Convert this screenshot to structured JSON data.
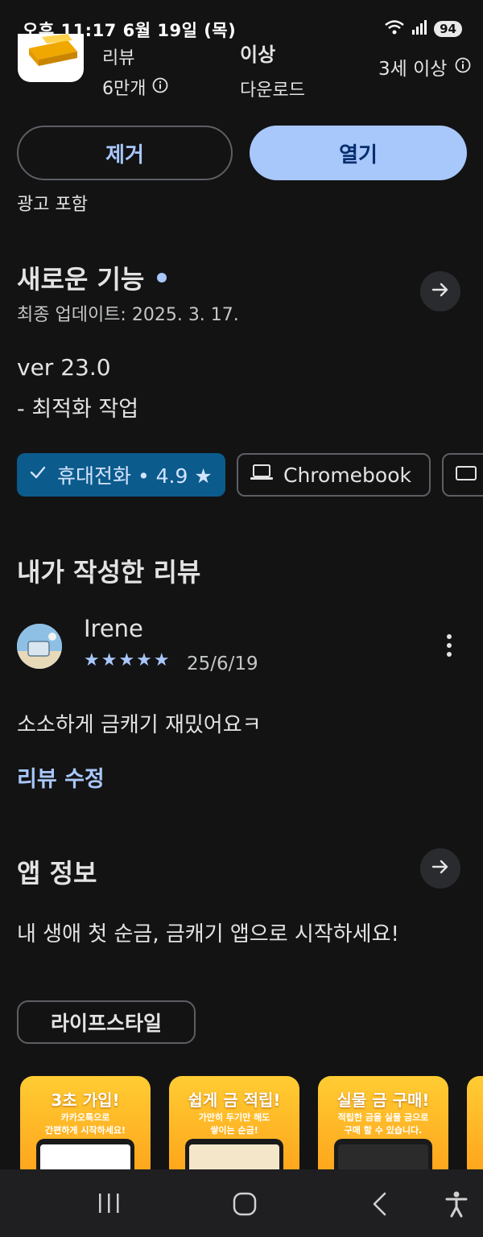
{
  "status_bar": {
    "time": "오후 11:17 6월 19일 (목)",
    "battery": "94"
  },
  "app_stats": {
    "reviews_label": "리뷰",
    "reviews_count": "6만개",
    "downloads_top": "이상",
    "downloads_label": "다운로드",
    "age_rating": "3세 이상"
  },
  "actions": {
    "remove": "제거",
    "open": "열기"
  },
  "ads_notice": "광고 포함",
  "whats_new": {
    "title": "새로운 기능",
    "last_updated": "최종 업데이트: 2025. 3. 17.",
    "version": "ver 23.0",
    "notes": "- 최적화 작업"
  },
  "device_chips": [
    {
      "label": "휴대전화 • 4.9 ★",
      "selected": true
    },
    {
      "label": "Chromebook",
      "selected": false
    },
    {
      "label": "",
      "selected": false
    }
  ],
  "my_review": {
    "title": "내가 작성한 리뷰",
    "author": "Irene",
    "rating": 5,
    "stars": "★★★★★",
    "date": "25/6/19",
    "text": "소소하게 금캐기 재밌어요ㅋ",
    "edit_label": "리뷰 수정"
  },
  "app_info": {
    "title": "앱 정보",
    "description": "내 생애 첫 순금, 금캐기 앱으로 시작하세요!",
    "category_tag": "라이프스타일"
  },
  "screenshots": [
    {
      "title": "3초 가입!",
      "line1": "카카오톡으로",
      "line2": "간편하게 시작하세요!"
    },
    {
      "title": "쉽게 금 적립!",
      "line1": "가만히 두기만 해도",
      "line2": "쌓이는 순금!"
    },
    {
      "title": "실물 금 구매!",
      "line1": "적립한 금을 실물 금으로",
      "line2": "구매 할 수 있습니다."
    }
  ],
  "colors": {
    "background": "#131314",
    "accent": "#a8c7fa",
    "chip_selected": "#0b5b8c"
  }
}
